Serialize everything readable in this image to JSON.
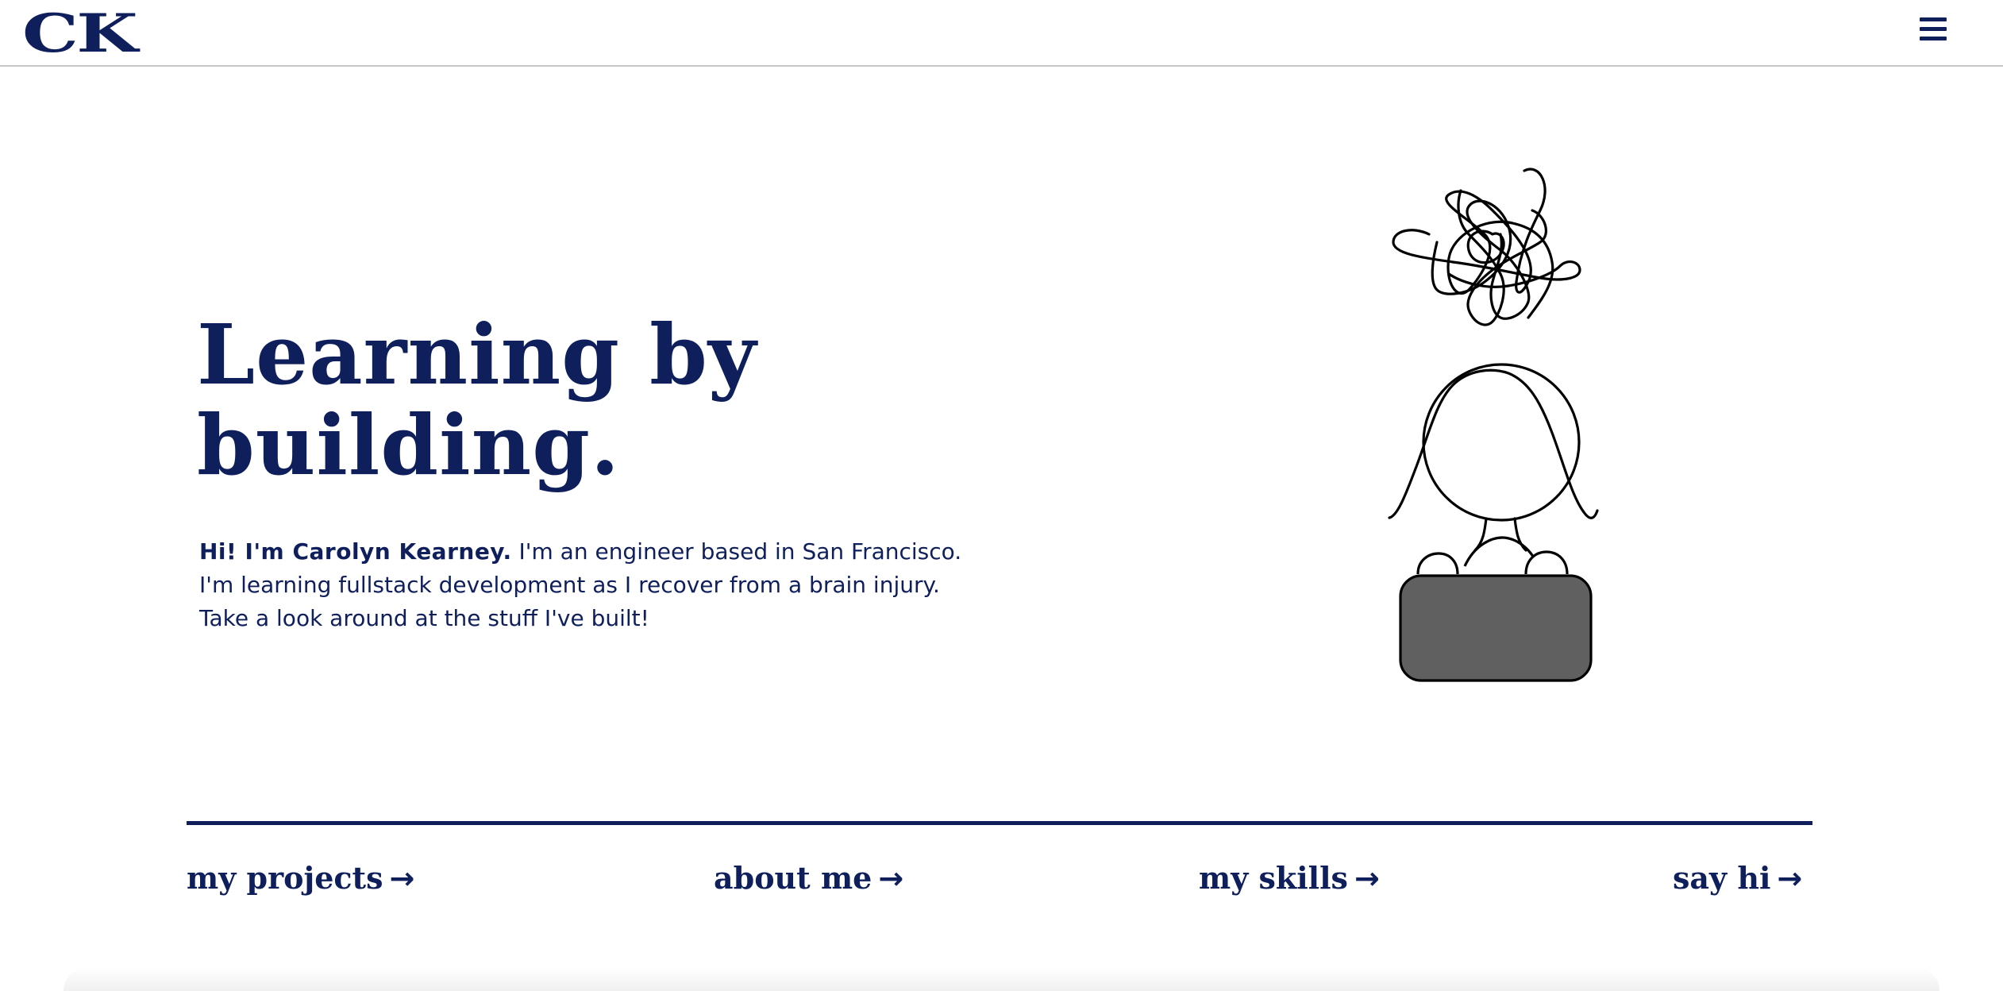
{
  "header": {
    "logo_text": "CK",
    "menu_icon": "hamburger-menu-icon"
  },
  "hero": {
    "title_line1": "Learning by",
    "title_line2": "building.",
    "intro_bold": "Hi! I'm Carolyn Kearney.",
    "intro_text": " I'm an engineer based in San Francisco. I'm learning fullstack development as I recover from a brain injury. Take a look around at the stuff I've built!",
    "illustration": "person-with-laptop-and-scribble-illustration"
  },
  "nav_links": {
    "projects": "my projects",
    "about": "about me",
    "skills": "my skills",
    "sayhi": "say hi",
    "arrow": "→"
  },
  "colors": {
    "primary": "#0f1f5c",
    "laptop": "#606060",
    "background": "#ffffff"
  }
}
